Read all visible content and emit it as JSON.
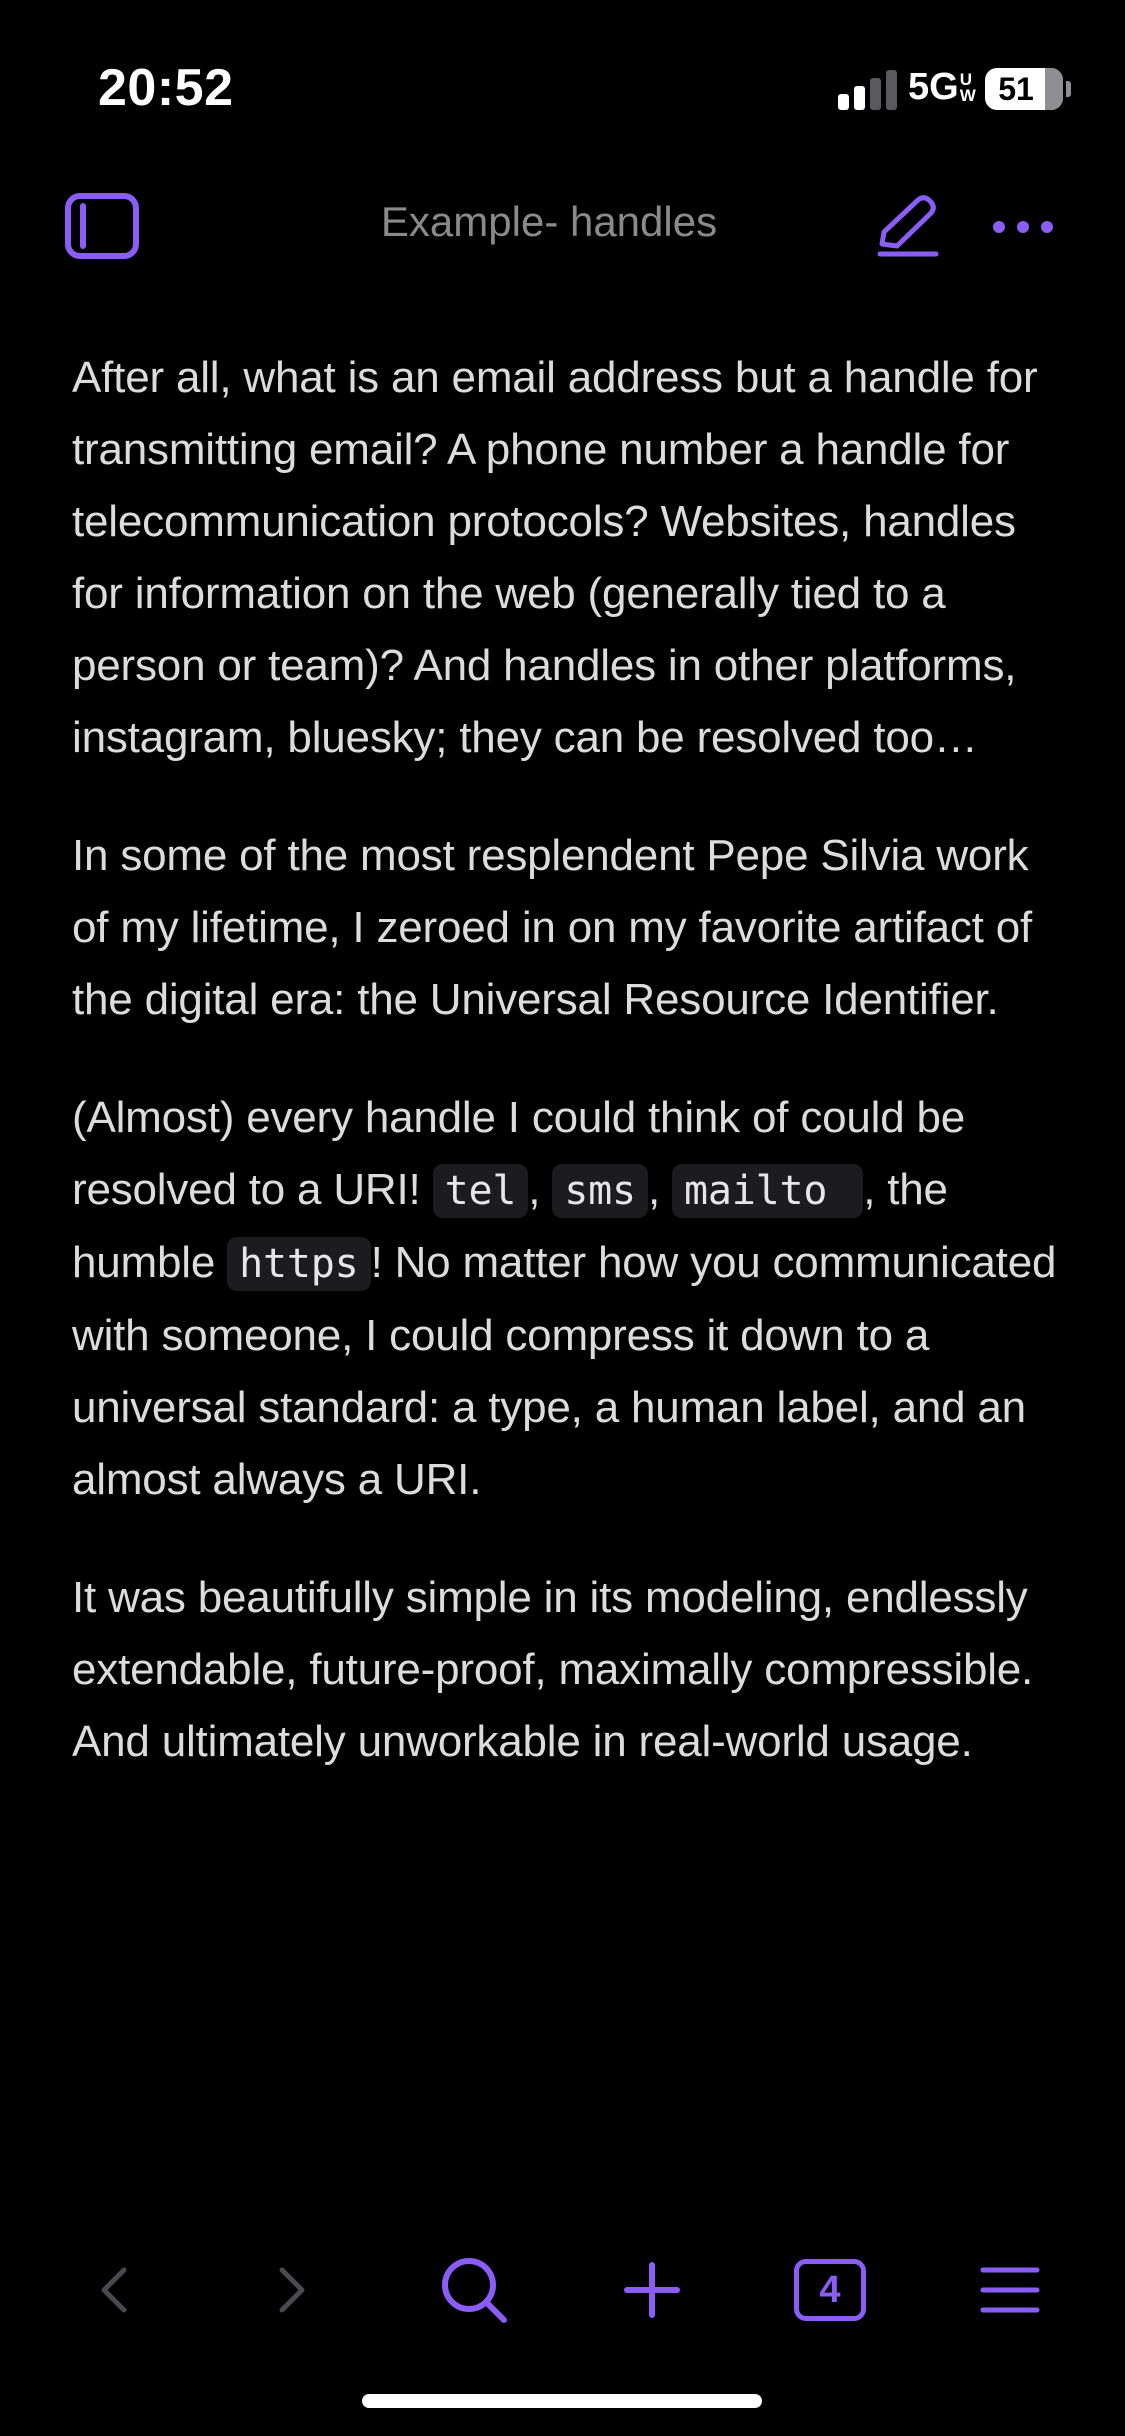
{
  "status_bar": {
    "time": "20:52",
    "network": "5G",
    "network_sub": [
      "U",
      "W"
    ],
    "battery": "51",
    "signal_bars_active": 2,
    "signal_bars_total": 4
  },
  "nav": {
    "title": "Example- handles",
    "accent_color": "#8b5cf6",
    "icons": [
      "sidebar-toggle-icon",
      "pencil-icon",
      "ellipsis-icon"
    ]
  },
  "content": {
    "paragraphs": [
      {
        "text": "After all, what is an email address but a handle for transmitting email? A phone number a handle for telecommunication protocols? Websites, handles for information on the web (generally tied to a person or team)? And handles in other platforms, instagram, bluesky; they can be resolved too…"
      },
      {
        "text": "In some of the most resplendent Pepe Silvia work of my lifetime, I zeroed in on my favorite artifact of the digital era: the Universal Resource Identifier."
      },
      {
        "before_code": "(Almost) every handle I could think of could be resolved to a URI! ",
        "code1": "tel",
        "sep1": ", ",
        "code2": "sms",
        "sep2": ", ",
        "code3": "mailto ",
        "sep3": ", the humble ",
        "code4": "https",
        "after_code": "! No matter how you communicated with someone, I could compress it down to a universal standard: a type, a human label, and an almost always a URI."
      },
      {
        "text": "It was beautifully simple in its modeling, endlessly extendable, future-proof, maximally compressible. And ultimately unworkable in real-world usage."
      }
    ]
  },
  "toolbar": {
    "tab_count": "4",
    "icons": [
      "back-icon",
      "forward-icon",
      "search-icon",
      "plus-icon",
      "tabs-icon",
      "menu-icon"
    ],
    "disabled_color": "#4a4a4e"
  }
}
